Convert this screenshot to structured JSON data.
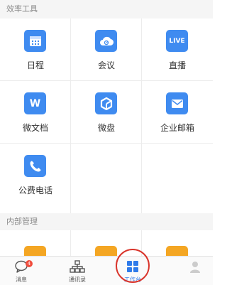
{
  "sections": {
    "efficiency_title": "效率工具",
    "internal_title": "内部管理"
  },
  "tools": [
    {
      "label": "日程",
      "icon": "calendar-icon"
    },
    {
      "label": "会议",
      "icon": "cloud-meeting-icon"
    },
    {
      "label": "直播",
      "icon": "live-icon",
      "icon_text": "LIVE"
    },
    {
      "label": "微文档",
      "icon": "doc-icon",
      "icon_text": "W"
    },
    {
      "label": "微盘",
      "icon": "drive-icon"
    },
    {
      "label": "企业邮箱",
      "icon": "mail-icon"
    },
    {
      "label": "公费电话",
      "icon": "phone-icon"
    }
  ],
  "tabbar": {
    "messages": {
      "label": "消息",
      "badge": "4"
    },
    "contacts": {
      "label": "通讯录"
    },
    "workbench": {
      "label": "工作台"
    }
  },
  "colors": {
    "tool_icon_blue": "#3f8bf0",
    "internal_icon_orange": "#f4a623",
    "active_tab": "#2f7bea",
    "highlight_ring": "#d9342b"
  }
}
